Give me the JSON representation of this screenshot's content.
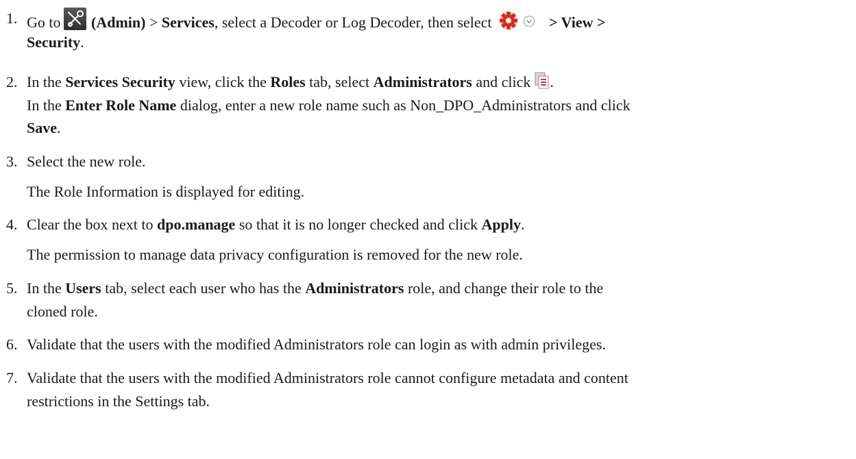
{
  "steps": [
    {
      "number": "1.",
      "l1_a": "Go to",
      "l1_b": "(Admin)",
      "l1_c": " > ",
      "l1_d": "Services",
      "l1_e": ", select a Decoder or Log Decoder, then select",
      "l1_f": "> View >",
      "l2_a": "Security",
      "l2_b": ".",
      "icons": [
        "admin-icon",
        "gear-icon",
        "chevron-down-icon"
      ]
    },
    {
      "number": "2.",
      "l1_a": "In the ",
      "l1_b": "Services Security",
      "l1_c": " view, click the ",
      "l1_d": "Roles",
      "l1_e": " tab, select ",
      "l1_f": "Administrators",
      "l1_g": " and click",
      "l1_h": ".",
      "l2_a": "In the ",
      "l2_b": "Enter Role Name",
      "l2_c": " dialog, enter a new role name such as Non_DPO_Administrators and click",
      "l3_a": "Save",
      "l3_b": ".",
      "icons": [
        "clone-icon"
      ]
    },
    {
      "number": "3.",
      "l1_a": "Select the new role.",
      "l2_a": "The Role Information is displayed for editing."
    },
    {
      "number": "4.",
      "l1_a": "Clear the box next to ",
      "l1_b": "dpo.manage",
      "l1_c": " so that it is no longer checked and click ",
      "l1_d": "Apply",
      "l1_e": ".",
      "l2_a": "The permission to manage data privacy configuration is removed for the new role."
    },
    {
      "number": "5.",
      "l1_a": "In the ",
      "l1_b": "Users",
      "l1_c": " tab, select each user who has the ",
      "l1_d": "Administrators",
      "l1_e": " role, and change their role to the",
      "l2_a": "cloned role."
    },
    {
      "number": "6.",
      "l1_a": "Validate that the users with the modified Administrators role can login as with admin privileges."
    },
    {
      "number": "7.",
      "l1_a": "Validate that the users with the modified Administrators role cannot configure metadata and content",
      "l2_a": "restrictions in the Settings tab."
    }
  ]
}
